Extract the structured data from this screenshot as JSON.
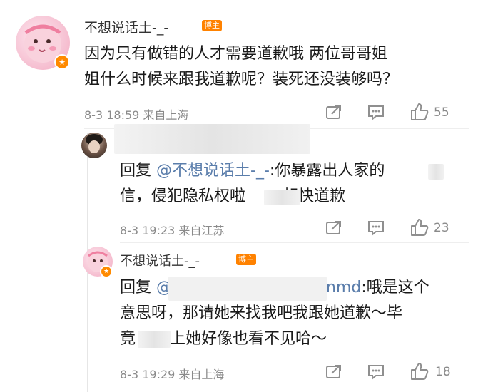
{
  "comments": [
    {
      "author": "不想说话土-_-",
      "author_tag": "博主",
      "text_lines": [
        "因为只有做错的人才需要道歉哦 两位哥哥姐",
        "姐什么时候来跟我道歉呢？装死还没装够吗？"
      ],
      "meta": "8-3 18:59  来自上海",
      "likes": "55"
    },
    {
      "reply_prefix": "回复",
      "mention": "@不想说话土-_-",
      "line1_rest": ":你暴露出人家的",
      "line2_start": "信，侵犯隐私权啦",
      "line2_end": "赶快道歉",
      "meta": "8-3 19:23  来自江苏",
      "likes": "23"
    },
    {
      "author": "不想说话土-_-",
      "author_tag": "博主",
      "reply_prefix": "回复",
      "mention_start": "@",
      "mention_end": "nmd",
      "line1_rest": ":哦是这个",
      "line2": "意思呀，那请她来找我吧我跟她道歉～毕",
      "line3_start": "竟",
      "line3_end": "上她好像也看不见哈～",
      "meta": "8-3 19:29  来自上海",
      "likes": "18"
    }
  ],
  "icons": [
    "share-icon",
    "comment-icon",
    "like-icon"
  ]
}
